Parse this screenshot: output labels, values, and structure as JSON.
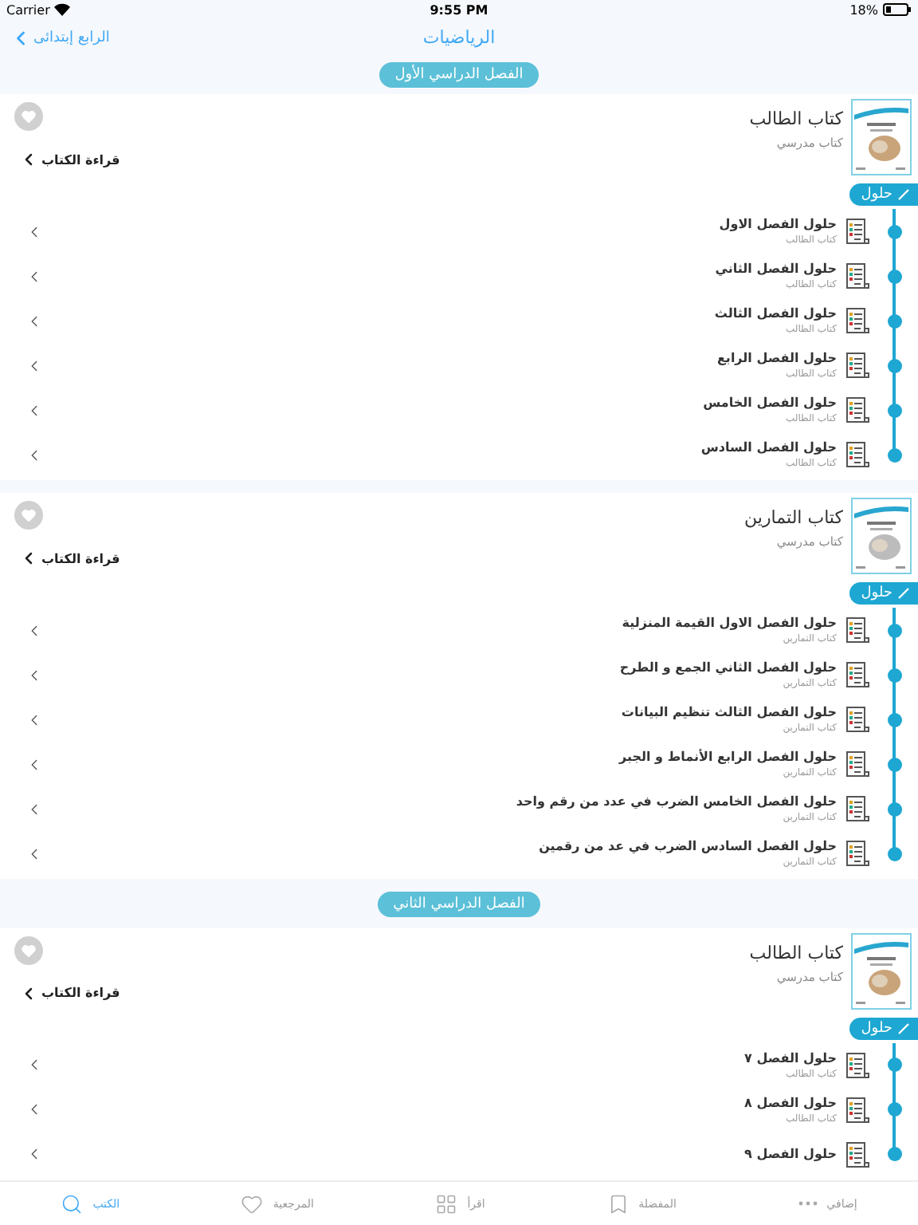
{
  "status_bar": {
    "carrier": "Carrier",
    "time": "9:55 PM",
    "battery": "18%"
  },
  "nav": {
    "back": "الرابع إبتدائى",
    "title": "الرياضيات"
  },
  "semesters": [
    {
      "label": "الفصل الدراسي الأول",
      "books": [
        {
          "title": "كتاب الطالب",
          "subtitle": "كتاب مدرسي",
          "kind": "student",
          "read": "قراءة الكتاب",
          "tag": "حلول",
          "chapters": [
            {
              "title": "حلول الفصل الاول",
              "subtitle": "كتاب الطالب"
            },
            {
              "title": "حلول الفصل الثاني",
              "subtitle": "كتاب الطالب"
            },
            {
              "title": "حلول الفصل الثالث",
              "subtitle": "كتاب الطالب"
            },
            {
              "title": "حلول الفصل الرابع",
              "subtitle": "كتاب الطالب"
            },
            {
              "title": "حلول الفصل الخامس",
              "subtitle": "كتاب الطالب"
            },
            {
              "title": "حلول الفصل السادس",
              "subtitle": "كتاب الطالب"
            }
          ]
        },
        {
          "title": "كتاب التمارين",
          "subtitle": "كتاب مدرسي",
          "kind": "exercises",
          "read": "قراءة الكتاب",
          "tag": "حلول",
          "chapters": [
            {
              "title": "حلول الفصل الاول القيمة المنزلية",
              "subtitle": "كتاب التمارين"
            },
            {
              "title": "حلول الفصل الثاني الجمع و الطرح",
              "subtitle": "كتاب التمارين"
            },
            {
              "title": "حلول الفصل الثالث تنظيم البيانات",
              "subtitle": "كتاب التمارين"
            },
            {
              "title": "حلول الفصل الرابع الأنماط و الجبر",
              "subtitle": "كتاب التمارين"
            },
            {
              "title": "حلول الفصل الخامس الضرب في عدد من رقم واحد",
              "subtitle": "كتاب التمارين"
            },
            {
              "title": "حلول الفصل السادس الضرب في عد من رقمين",
              "subtitle": "كتاب التمارين"
            }
          ]
        }
      ]
    },
    {
      "label": "الفصل الدراسي الثاني",
      "books": [
        {
          "title": "كتاب الطالب",
          "subtitle": "كتاب مدرسي",
          "kind": "student",
          "read": "قراءة الكتاب",
          "tag": "حلول",
          "chapters": [
            {
              "title": "حلول الفصل ٧",
              "subtitle": "كتاب الطالب"
            },
            {
              "title": "حلول الفصل ٨",
              "subtitle": "كتاب الطالب"
            },
            {
              "title": "حلول الفصل ٩"
            }
          ]
        }
      ]
    }
  ],
  "tab_bar": [
    {
      "label": "إضافي",
      "kind": "more",
      "selected": false
    },
    {
      "label": "المفضلة",
      "kind": "bookmark",
      "selected": false
    },
    {
      "label": "اقرأ",
      "kind": "grid",
      "selected": false
    },
    {
      "label": "المرجعية",
      "kind": "heart",
      "selected": false
    },
    {
      "label": "الكتب",
      "kind": "search",
      "selected": true
    }
  ]
}
